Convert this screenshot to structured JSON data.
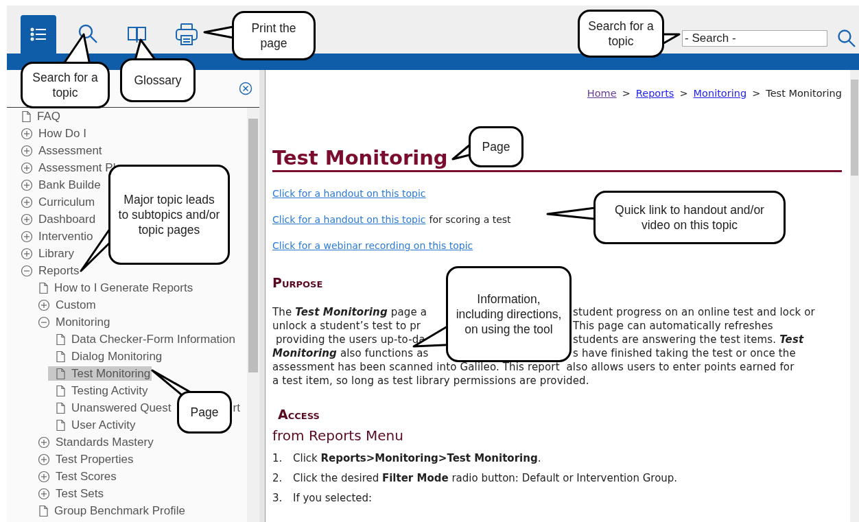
{
  "toolbar": {
    "tabs": [
      {
        "kind": "contents",
        "selected": true
      },
      {
        "kind": "search",
        "selected": false
      },
      {
        "kind": "glossary",
        "selected": false
      },
      {
        "kind": "print",
        "selected": false
      }
    ],
    "search": {
      "placeholder": "- Search -"
    }
  },
  "sidebar": {
    "tree": [
      {
        "label": "FAQ",
        "kind": "page",
        "selected": false
      },
      {
        "label": "How Do I",
        "kind": "topic",
        "expanded": false,
        "selected": false
      },
      {
        "label": "Assessment",
        "kind": "topic",
        "expanded": false,
        "selected": false
      },
      {
        "label": "Assessment Pl",
        "kind": "topic",
        "expanded": false,
        "selected": false
      },
      {
        "label": "Bank Builde",
        "kind": "topic",
        "expanded": false,
        "selected": false
      },
      {
        "label": "Curriculum",
        "kind": "topic",
        "expanded": false,
        "selected": false
      },
      {
        "label": "Dashboard",
        "kind": "topic",
        "expanded": false,
        "selected": false
      },
      {
        "label": "Interventio",
        "kind": "topic",
        "expanded": false,
        "selected": false
      },
      {
        "label": "Library",
        "kind": "topic",
        "expanded": false,
        "selected": false
      },
      {
        "label": "Reports",
        "kind": "topic",
        "expanded": true,
        "selected": false,
        "children": [
          {
            "label": "How to I Generate Reports",
            "kind": "page",
            "selected": false
          },
          {
            "label": "Custom",
            "kind": "topic",
            "expanded": false,
            "selected": false
          },
          {
            "label": "Monitoring",
            "kind": "topic",
            "expanded": true,
            "selected": false,
            "children": [
              {
                "label": "Data Checker-Form Information",
                "kind": "page",
                "selected": false
              },
              {
                "label": "Dialog Monitoring",
                "kind": "page",
                "selected": false
              },
              {
                "label": "Test Monitoring",
                "kind": "page",
                "selected": true
              },
              {
                "label": "Testing Activity",
                "kind": "page",
                "selected": false
              },
              {
                "label": "Unanswered Quest",
                "label_end": "rt",
                "kind": "page",
                "selected": false
              },
              {
                "label": "User Activity",
                "kind": "page",
                "selected": false
              }
            ]
          },
          {
            "label": "Standards Mastery",
            "kind": "topic",
            "expanded": false,
            "selected": false
          },
          {
            "label": "Test Properties",
            "kind": "topic",
            "expanded": false,
            "selected": false
          },
          {
            "label": "Test Scores",
            "kind": "topic",
            "expanded": false,
            "selected": false
          },
          {
            "label": "Test Sets",
            "kind": "topic",
            "expanded": false,
            "selected": false
          },
          {
            "label": "Group Benchmark Profile",
            "kind": "page",
            "selected": false
          }
        ]
      }
    ]
  },
  "content": {
    "breadcrumb": {
      "separator": ">",
      "items": [
        {
          "label": "Home",
          "kind": "visited"
        },
        {
          "label": "Reports",
          "kind": "link"
        },
        {
          "label": "Monitoring",
          "kind": "link"
        },
        {
          "label": "Test Monitoring",
          "kind": "current"
        }
      ]
    },
    "title": "Test Monitoring",
    "quick_links": [
      {
        "link": "Click for a handout on this topic"
      },
      {
        "link": "Click for a handout on this topic",
        "text": "for scoring a test"
      },
      {
        "link": "Click for a webinar recording on this topic"
      }
    ],
    "purpose_heading": "Purpose",
    "paragraph_lines": [
      {
        "left": "The **Test Monitoring** page a",
        "right": "student progress on an online test and lock or"
      },
      {
        "left": "unlock a student’s test to pr",
        "right": "This page can automatically refreshes"
      },
      {
        "left": " providing the users up-to-da",
        "right": "students are answering the test items. **Test**"
      },
      {
        "left": "**Monitoring** also functions as",
        "right": "s have finished taking the test or once the"
      },
      {
        "left": "assessment has been scanned into Galileo. This report  also allows users to enter points earned for"
      },
      {
        "left": "a test item, so long as test library permissions are provided."
      }
    ],
    "access_heading": "Access",
    "subheading": "from Reports Menu",
    "steps": [
      {
        "number": "1.",
        "text": "Click **Reports>Monitoring>Test Monitoring**."
      },
      {
        "number": "2.",
        "text": "Click the desired **Filter Mode** radio button:  Default or Intervention Group."
      },
      {
        "number": "3.",
        "text": "If you selected:"
      }
    ]
  },
  "callouts": [
    "Search for a topic",
    "Glossary",
    "Print the page",
    "Search for a topic",
    "Major topic leads to subtopics and/or topic pages",
    "Page",
    "Page",
    "Quick link to handout and/or video on this topic",
    "Information, including directions, on using the tool"
  ]
}
